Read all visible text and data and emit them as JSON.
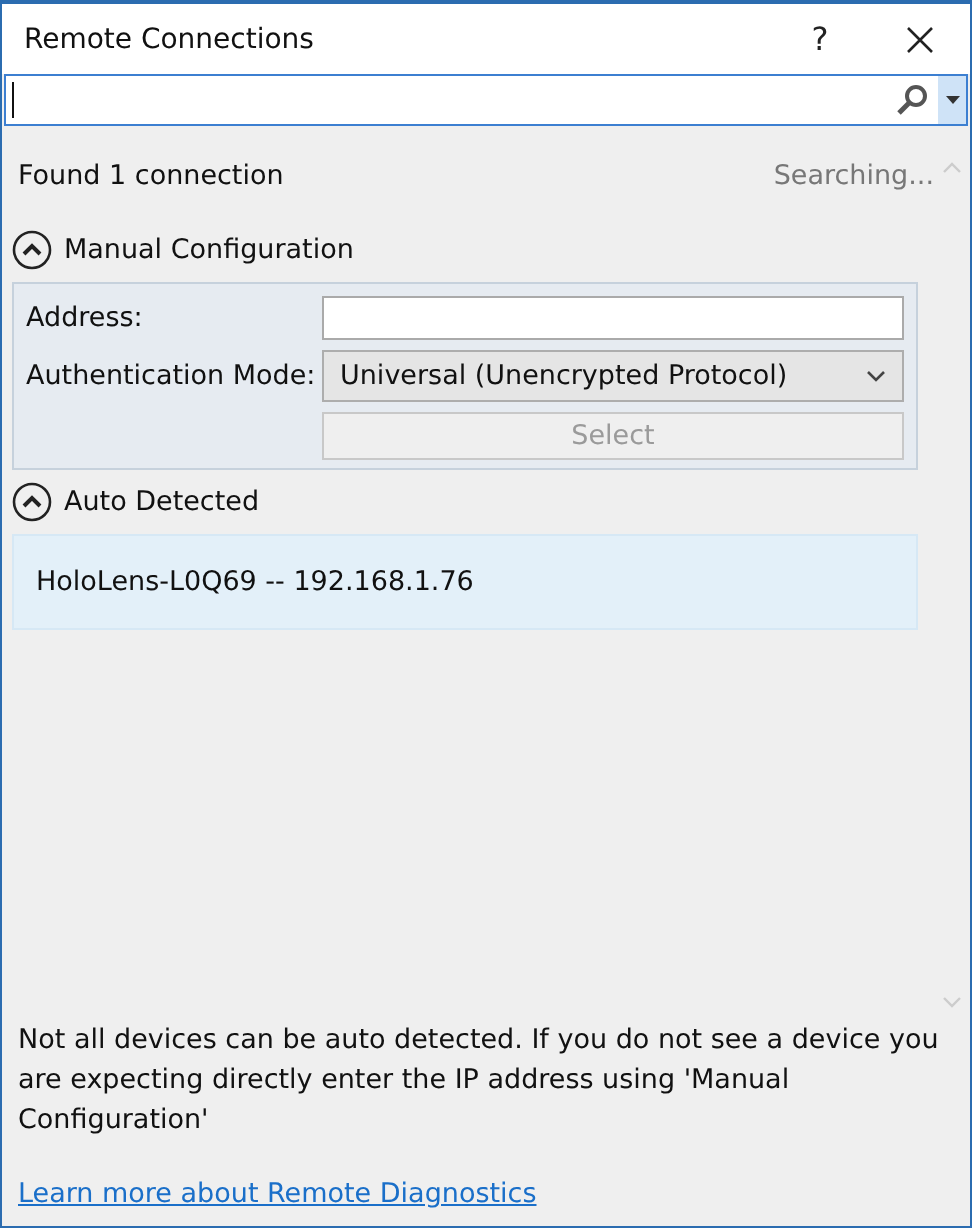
{
  "window": {
    "title": "Remote Connections",
    "help": "?"
  },
  "search": {
    "focused": true
  },
  "status": {
    "found": "Found 1 connection",
    "activity": "Searching..."
  },
  "manual": {
    "title": "Manual Configuration",
    "expanded": true,
    "address_label": "Address:",
    "auth_label": "Authentication Mode:",
    "auth_value": "Universal (Unencrypted Protocol)",
    "select_button": "Select",
    "select_disabled": true
  },
  "auto": {
    "title": "Auto Detected",
    "expanded": true,
    "devices": [
      {
        "label": "HoloLens-L0Q69 -- 192.168.1.76",
        "selected": true
      }
    ]
  },
  "footer": {
    "note": "Not all devices can be auto detected. If you do not see a device you are expecting directly enter the IP address using 'Manual Configuration'",
    "link": "Learn more about Remote Diagnostics"
  }
}
